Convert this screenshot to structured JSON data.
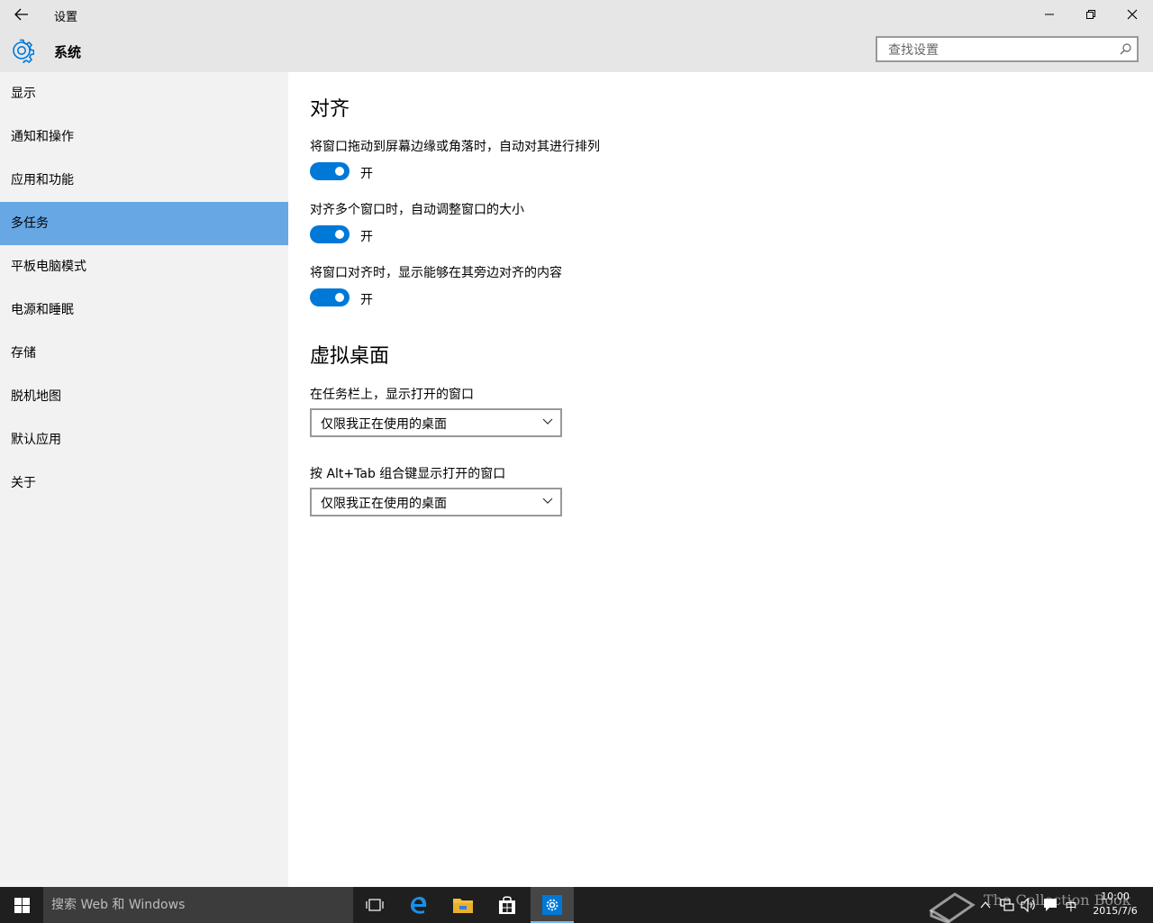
{
  "window": {
    "title": "设置"
  },
  "header": {
    "title": "系统",
    "search_placeholder": "查找设置"
  },
  "sidebar": {
    "active_index": 3,
    "items": [
      {
        "label": "显示"
      },
      {
        "label": "通知和操作"
      },
      {
        "label": "应用和功能"
      },
      {
        "label": "多任务"
      },
      {
        "label": "平板电脑模式"
      },
      {
        "label": "电源和睡眠"
      },
      {
        "label": "存储"
      },
      {
        "label": "脱机地图"
      },
      {
        "label": "默认应用"
      },
      {
        "label": "关于"
      }
    ]
  },
  "snap": {
    "heading": "对齐",
    "settings": [
      {
        "label": "将窗口拖动到屏幕边缘或角落时，自动对其进行排列",
        "state": "开",
        "on": true
      },
      {
        "label": "对齐多个窗口时，自动调整窗口的大小",
        "state": "开",
        "on": true
      },
      {
        "label": "将窗口对齐时，显示能够在其旁边对齐的内容",
        "state": "开",
        "on": true
      }
    ]
  },
  "virtual_desktops": {
    "heading": "虚拟桌面",
    "dropdowns": [
      {
        "label": "在任务栏上，显示打开的窗口",
        "value": "仅限我正在使用的桌面"
      },
      {
        "label": "按 Alt+Tab 组合键显示打开的窗口",
        "value": "仅限我正在使用的桌面"
      }
    ]
  },
  "taskbar": {
    "search_text": "搜索 Web 和 Windows",
    "ime": "中",
    "time": "10:00",
    "date": "2015/7/6"
  },
  "watermark": {
    "text": "The Collection Book"
  },
  "colors": {
    "accent": "#0078d7",
    "active_nav": "#66a7e4",
    "chrome": "#e6e6e6",
    "sidebar": "#f2f2f2",
    "taskbar": "#1f1f1f"
  },
  "icons": [
    "back-arrow-icon",
    "minimize-icon",
    "maximize-icon",
    "close-icon",
    "gear-icon",
    "search-icon",
    "chevron-down-icon",
    "windows-logo-icon",
    "task-view-icon",
    "edge-icon",
    "file-explorer-icon",
    "store-icon",
    "settings-app-icon",
    "chevron-up-icon",
    "network-icon",
    "volume-icon",
    "action-center-icon"
  ]
}
